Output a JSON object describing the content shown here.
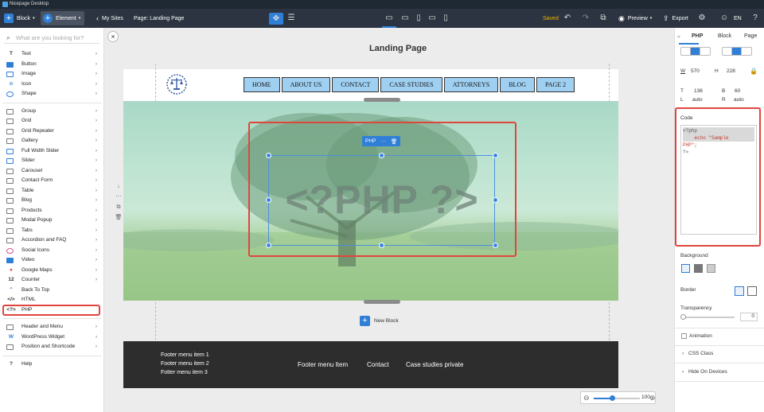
{
  "window": {
    "title": "Nicepage Desktop"
  },
  "toolbar": {
    "block_label": "Block",
    "element_label": "Element",
    "my_sites": "My Sites",
    "page_label": "Page: Landing Page",
    "saved": "Saved",
    "preview": "Preview",
    "export": "Export",
    "language": "EN"
  },
  "sidebar": {
    "search_placeholder": "What are you looking for?",
    "group1": [
      "Text",
      "Button",
      "Image",
      "Icon",
      "Shape"
    ],
    "group2": [
      "Group",
      "Grid",
      "Grid Repeater",
      "Gallery",
      "Full Width Slider",
      "Slider",
      "Carousel",
      "Contact Form",
      "Table",
      "Blog",
      "Products",
      "Modal Popup",
      "Tabs",
      "Accordion and FAQ",
      "Social Icons",
      "Video",
      "Google Maps",
      "Counter",
      "Back To Top",
      "HTML",
      "PHP"
    ],
    "group3": [
      "Header and Menu",
      "WordPress Widget",
      "Position and Shortcode"
    ],
    "help": "Help",
    "counter_glyph": "12"
  },
  "canvas": {
    "page_title": "Landing Page",
    "nav": [
      "HOME",
      "ABOUT US",
      "CONTACT",
      "CASE STUDIES",
      "ATTORNEYS",
      "BLOG",
      "PAGE 2"
    ],
    "php_text": "<?PHP ?>",
    "php_tag": "PHP",
    "new_block": "New Block",
    "footer_col1": [
      "Footer menu item 1",
      "Footer menu item 2",
      "Fotter menu item 3"
    ],
    "footer_links": [
      "Footer menu Item",
      "Contact",
      "Case studies private"
    ],
    "zoom_value": "100"
  },
  "right_panel": {
    "tabs": [
      "PHP",
      "Block",
      "Page"
    ],
    "w_label": "W",
    "w_value": "570",
    "h_label": "H",
    "h_value": "228",
    "t_label": "T",
    "t_value": "136",
    "b_label": "B",
    "b_value": "60",
    "l_label": "L",
    "l_value": "auto",
    "r_label": "R",
    "r_value": "auto",
    "code_label": "Code",
    "code_lines": [
      "<?php",
      "    echo \"Sample",
      "PHP\";",
      "?>"
    ],
    "background_label": "Background",
    "border_label": "Border",
    "transparency_label": "Transparency",
    "transparency_value": "0",
    "animation_label": "Animation",
    "css_class_label": "CSS Class",
    "hide_devices_label": "Hide On Devices"
  },
  "colors": {
    "accent": "#2f7fd7",
    "highlight": "#e0453d",
    "toolbar": "#2b3440"
  }
}
